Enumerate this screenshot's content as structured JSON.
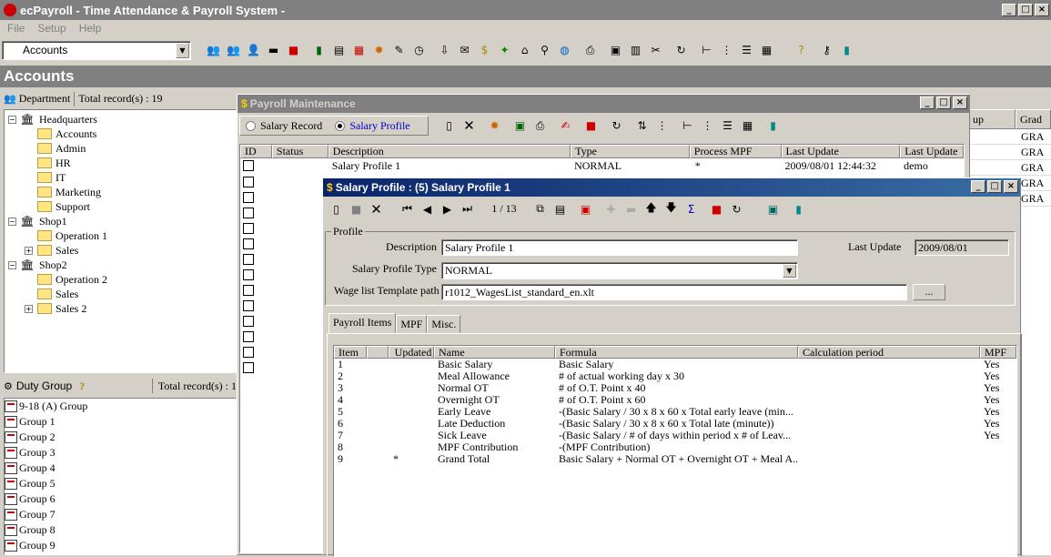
{
  "app": {
    "title": "ecPayroll - Time Attendance & Payroll System -",
    "menu": [
      "File",
      "Setup",
      "Help"
    ],
    "module_select": "Accounts",
    "section_title": "Accounts"
  },
  "department": {
    "label": "Department",
    "total": "Total record(s) : 19",
    "tree": [
      {
        "label": "Headquarters",
        "level": 0,
        "kind": "building",
        "exp": "-"
      },
      {
        "label": "Accounts",
        "level": 1,
        "kind": "folder"
      },
      {
        "label": "Admin",
        "level": 1,
        "kind": "folder"
      },
      {
        "label": "HR",
        "level": 1,
        "kind": "folder"
      },
      {
        "label": "IT",
        "level": 1,
        "kind": "folder"
      },
      {
        "label": "Marketing",
        "level": 1,
        "kind": "folder"
      },
      {
        "label": "Support",
        "level": 1,
        "kind": "folder"
      },
      {
        "label": "Shop1",
        "level": 0,
        "kind": "building",
        "exp": "-"
      },
      {
        "label": "Operation 1",
        "level": 1,
        "kind": "folder"
      },
      {
        "label": "Sales",
        "level": 1,
        "kind": "folder",
        "exp": "+"
      },
      {
        "label": "Shop2",
        "level": 0,
        "kind": "building",
        "exp": "-"
      },
      {
        "label": "Operation 2",
        "level": 1,
        "kind": "folder"
      },
      {
        "label": "Sales",
        "level": 1,
        "kind": "folder"
      },
      {
        "label": "Sales 2",
        "level": 1,
        "kind": "folder",
        "exp": "+"
      }
    ]
  },
  "duty": {
    "label": "Duty Group",
    "total": "Total record(s) : 1",
    "items": [
      "9-18 (A) Group",
      "Group 1",
      "Group 2",
      "Group 3",
      "Group 4",
      "Group 5",
      "Group 6",
      "Group 7",
      "Group 8",
      "Group 9"
    ]
  },
  "right_grid": {
    "col1": "up",
    "col2": "Grad",
    "cells": [
      "GRA",
      "GRA",
      "GRA",
      "GRA",
      "GRA"
    ]
  },
  "payroll": {
    "title": "Payroll Maintenance",
    "radio1": "Salary Record",
    "radio2": "Salary Profile",
    "columns": [
      "ID",
      "Status",
      "Description",
      "Type",
      "Process MPF",
      "Last Update",
      "Last Update"
    ],
    "row": {
      "description": "Salary Profile 1",
      "type": "NORMAL",
      "mpf": "*",
      "updated": "2009/08/01 12:44:32",
      "by": "demo"
    }
  },
  "profile": {
    "title": "Salary Profile : (5) Salary Profile 1",
    "record_counter": "1 / 13",
    "group_label": "Profile",
    "description_label": "Description",
    "description_value": "Salary Profile 1",
    "last_update_label": "Last Update",
    "last_update_value": "2009/08/01",
    "type_label": "Salary Profile Type",
    "type_value": "NORMAL",
    "template_label": "Wage list Template path",
    "template_value": "r1012_WagesList_standard_en.xlt",
    "browse": "...",
    "tabs": [
      "Payroll Items",
      "MPF",
      "Misc."
    ],
    "item_columns": [
      "Item",
      "",
      "Updated",
      "Name",
      "Formula",
      "Calculation period",
      "MPF"
    ],
    "items": [
      {
        "no": "1",
        "upd": "",
        "name": "Basic Salary",
        "formula": "Basic Salary",
        "mpf": "Yes"
      },
      {
        "no": "2",
        "upd": "",
        "name": "Meal Allowance",
        "formula": "# of actual working day x 30",
        "mpf": "Yes"
      },
      {
        "no": "3",
        "upd": "",
        "name": "Normal OT",
        "formula": "# of O.T. Point x 40",
        "mpf": "Yes"
      },
      {
        "no": "4",
        "upd": "",
        "name": "Overnight OT",
        "formula": "# of O.T. Point x 60",
        "mpf": "Yes"
      },
      {
        "no": "5",
        "upd": "",
        "name": "Early Leave",
        "formula": "-(Basic Salary / 30 x 8 x 60 x Total early leave (min...",
        "mpf": "Yes"
      },
      {
        "no": "6",
        "upd": "",
        "name": "Late Deduction",
        "formula": "-(Basic Salary / 30 x 8 x 60 x Total late (minute))",
        "mpf": "Yes"
      },
      {
        "no": "7",
        "upd": "",
        "name": "Sick Leave",
        "formula": "-(Basic Salary / # of days within period x # of  Leav...",
        "mpf": "Yes"
      },
      {
        "no": "8",
        "upd": "",
        "name": "MPF Contribution",
        "formula": "-(MPF Contribution)",
        "mpf": ""
      },
      {
        "no": "9",
        "upd": "*",
        "name": "Grand Total",
        "formula": "Basic Salary + Normal OT + Overnight OT + Meal A...",
        "mpf": ""
      }
    ]
  },
  "colors": {
    "title_active": "#0a246a",
    "title_inactive": "#808080",
    "section_bar": "#808080",
    "radio_selected_text": "#0000cc"
  }
}
